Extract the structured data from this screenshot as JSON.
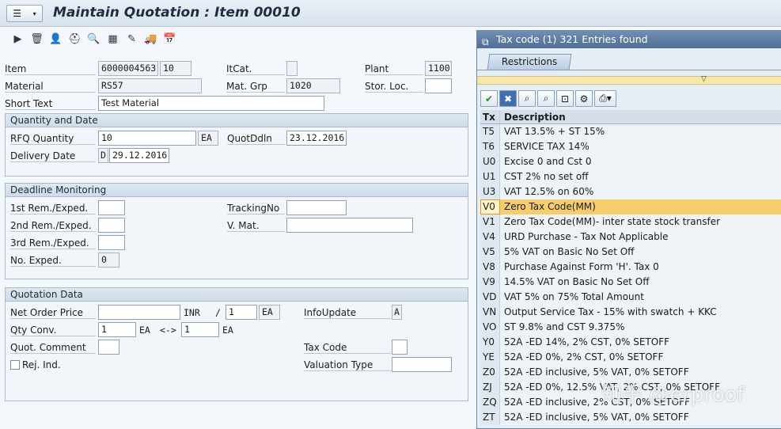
{
  "window": {
    "title": "Maintain Quotation : Item 00010"
  },
  "toolbar": {
    "icons": [
      "arrow-right-icon",
      "trash-icon",
      "partner-icon",
      "hat-icon",
      "zoom-icon",
      "structure-icon",
      "edit-icon",
      "truck-icon",
      "calendar-icon"
    ]
  },
  "header": {
    "item_label": "Item",
    "item_value": "6000004563",
    "item_pos": "10",
    "itcat_label": "ItCat.",
    "itcat_value": "",
    "plant_label": "Plant",
    "plant_value": "1100",
    "material_label": "Material",
    "material_value": "RS57",
    "matgrp_label": "Mat. Grp",
    "matgrp_value": "1020",
    "storloc_label": "Stor. Loc.",
    "storloc_value": "",
    "shorttext_label": "Short Text",
    "shorttext_value": "Test Material"
  },
  "qty_group": {
    "title": "Quantity and Date",
    "rfq_label": "RFQ Quantity",
    "rfq_value": "10",
    "rfq_unit": "EA",
    "quotddln_label": "QuotDdln",
    "quotddln_value": "23.12.2016",
    "deliv_label": "Delivery Date",
    "deliv_type": "D",
    "deliv_value": "29.12.2016"
  },
  "deadline_group": {
    "title": "Deadline Monitoring",
    "rem1_label": "1st Rem./Exped.",
    "rem2_label": "2nd Rem./Exped.",
    "rem3_label": "3rd Rem./Exped.",
    "noexp_label": "No. Exped.",
    "noexp_value": "0",
    "tracking_label": "TrackingNo",
    "vmat_label": "V. Mat."
  },
  "quote_group": {
    "title": "Quotation Data",
    "netprice_label": "Net Order Price",
    "currency": "INR",
    "slash": "/",
    "per_value": "1",
    "per_unit": "EA",
    "infoupd_label": "InfoUpdate",
    "infoupd_value": "A",
    "qtyconv_label": "Qty Conv.",
    "conv_left": "1",
    "conv_left_unit": "EA",
    "conv_arrow": "<->",
    "conv_right": "1",
    "conv_right_unit": "EA",
    "comment_label": "Quot. Comment",
    "taxcode_label": "Tax Code",
    "rej_label": "Rej. Ind.",
    "valtype_label": "Valuation Type"
  },
  "popup": {
    "title": "Tax code (1)  321 Entries found",
    "tab_label": "Restrictions",
    "col_tx": "Tx",
    "col_desc": "Description",
    "rows": [
      {
        "tx": "T5",
        "desc": "VAT 13.5% + ST 15%"
      },
      {
        "tx": "T6",
        "desc": "SERVICE TAX 14%"
      },
      {
        "tx": "U0",
        "desc": "Excise 0 and Cst 0"
      },
      {
        "tx": "U1",
        "desc": "CST 2% no set off"
      },
      {
        "tx": "U3",
        "desc": "VAT 12.5% on 60%"
      },
      {
        "tx": "V0",
        "desc": "Zero Tax Code(MM)",
        "selected": true
      },
      {
        "tx": "V1",
        "desc": "Zero Tax Code(MM)- inter state stock transfer"
      },
      {
        "tx": "V4",
        "desc": "URD Purchase - Tax Not Applicable"
      },
      {
        "tx": "V5",
        "desc": "5% VAT on Basic No Set Off"
      },
      {
        "tx": "V8",
        "desc": "Purchase Against Form 'H'. Tax 0"
      },
      {
        "tx": "V9",
        "desc": "14.5% VAT on Basic  No Set Off"
      },
      {
        "tx": "VD",
        "desc": "VAT 5% on 75% Total Amount"
      },
      {
        "tx": "VN",
        "desc": "Output Service Tax - 15% with swatch + KKC"
      },
      {
        "tx": "VO",
        "desc": "ST 9.8% and CST 9.375%"
      },
      {
        "tx": "Y0",
        "desc": "52A -ED 14%, 2% CST, 0% SETOFF"
      },
      {
        "tx": "YE",
        "desc": "52A -ED 0%, 2% CST, 0% SETOFF"
      },
      {
        "tx": "Z0",
        "desc": "52A -ED inclusive, 5% VAT, 0% SETOFF"
      },
      {
        "tx": "ZJ",
        "desc": "52A -ED 0%, 12.5% VAT, 2% CST, 0% SETOFF"
      },
      {
        "tx": "ZQ",
        "desc": "52A -ED inclusive, 2% CST, 0% SETOFF"
      },
      {
        "tx": "ZT",
        "desc": "52A -ED inclusive, 5% VAT, 0% SETOFF"
      }
    ]
  },
  "watermark": "知乎 @erproof"
}
